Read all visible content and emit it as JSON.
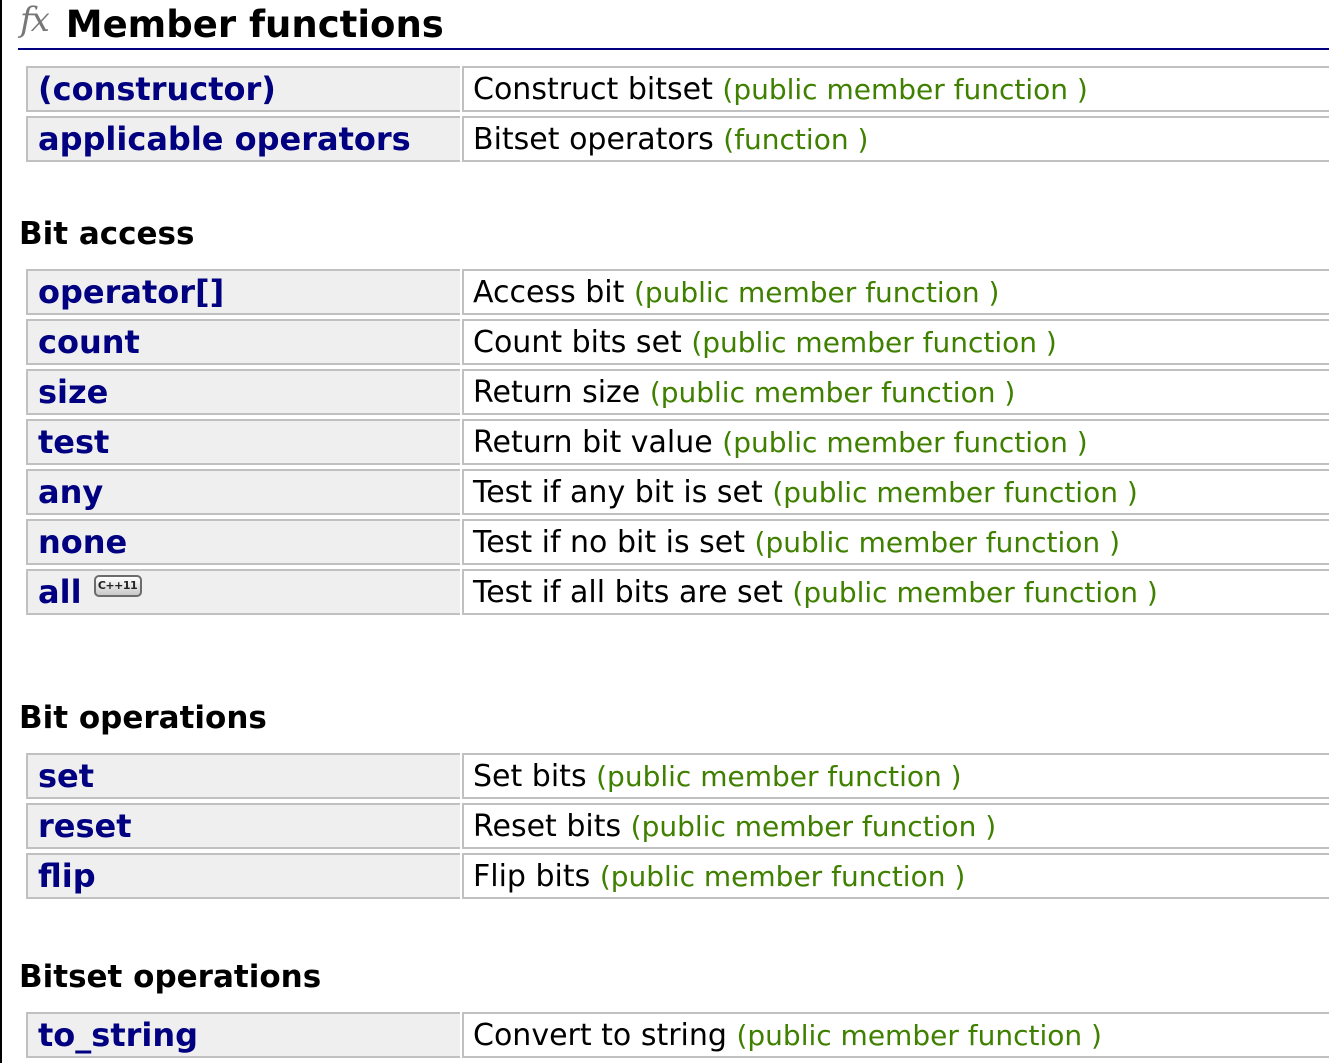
{
  "header": {
    "icon": "fx-icon",
    "title": "Member functions"
  },
  "groups": [
    {
      "heading": "",
      "rows": [
        {
          "name": "(constructor)",
          "desc": "Construct bitset",
          "kind": "(public member function )"
        },
        {
          "name": "applicable operators",
          "desc": "Bitset operators",
          "kind": "(function )"
        }
      ]
    },
    {
      "heading": "Bit access",
      "rows": [
        {
          "name": "operator[]",
          "desc": "Access bit",
          "kind": "(public member function )"
        },
        {
          "name": "count",
          "desc": "Count bits set",
          "kind": "(public member function )"
        },
        {
          "name": "size",
          "desc": "Return size",
          "kind": "(public member function )"
        },
        {
          "name": "test",
          "desc": "Return bit value",
          "kind": "(public member function )"
        },
        {
          "name": "any",
          "desc": "Test if any bit is set",
          "kind": "(public member function )"
        },
        {
          "name": "none",
          "desc": "Test if no bit is set",
          "kind": "(public member function )"
        },
        {
          "name": "all",
          "badge": "C++11",
          "desc": "Test if all bits are set",
          "kind": "(public member function )"
        }
      ]
    },
    {
      "heading": "Bit operations",
      "rows": [
        {
          "name": "set",
          "desc": "Set bits",
          "kind": "(public member function )"
        },
        {
          "name": "reset",
          "desc": "Reset bits",
          "kind": "(public member function )"
        },
        {
          "name": "flip",
          "desc": "Flip bits",
          "kind": "(public member function )"
        }
      ]
    },
    {
      "heading": "Bitset operations",
      "rows": [
        {
          "name": "to_string",
          "desc": "Convert to string",
          "kind": "(public member function )"
        }
      ]
    }
  ],
  "colors": {
    "link": "#000080",
    "kind": "#408000",
    "name_cell_bg": "#efefef",
    "border": "#c0c0c0"
  }
}
